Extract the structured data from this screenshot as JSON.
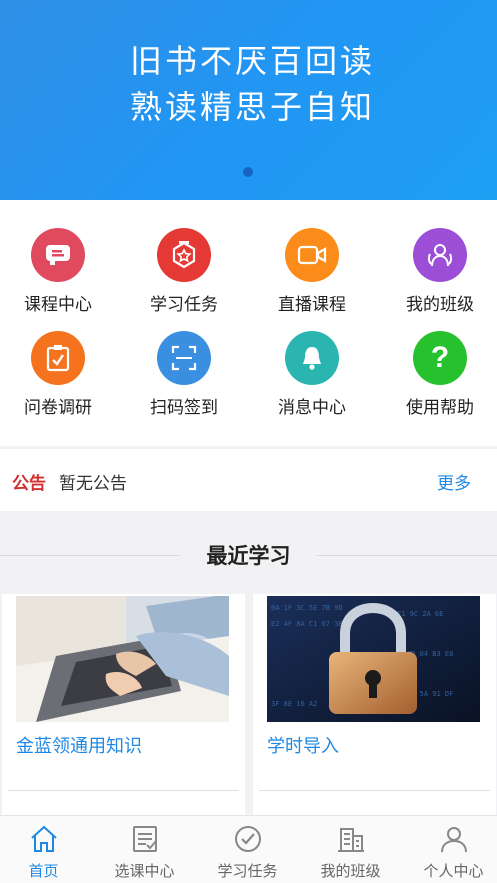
{
  "banner": {
    "line1": "旧书不厌百回读",
    "line2": "熟读精思子自知"
  },
  "menu": [
    {
      "label": "课程中心",
      "icon": "course-icon",
      "color": "#e04a5f"
    },
    {
      "label": "学习任务",
      "icon": "task-badge-icon",
      "color": "#e53935"
    },
    {
      "label": "直播课程",
      "icon": "video-camera-icon",
      "color": "#fb8c1a"
    },
    {
      "label": "我的班级",
      "icon": "class-people-icon",
      "color": "#9c4fd6"
    },
    {
      "label": "问卷调研",
      "icon": "clipboard-check-icon",
      "color": "#f5721e"
    },
    {
      "label": "扫码签到",
      "icon": "scan-qr-icon",
      "color": "#3b8fe0"
    },
    {
      "label": "消息中心",
      "icon": "bell-icon",
      "color": "#2bb5b0"
    },
    {
      "label": "使用帮助",
      "icon": "question-icon",
      "color": "#27c12d"
    }
  ],
  "notice": {
    "tag": "公告",
    "text": "暂无公告",
    "more": "更多"
  },
  "recent": {
    "title": "最近学习",
    "cards": [
      {
        "title": "金蓝领通用知识",
        "image": "laptop-typing-photo"
      },
      {
        "title": "学时导入",
        "image": "padlock-data-photo"
      }
    ]
  },
  "tabs": [
    {
      "label": "首页",
      "icon": "home-icon",
      "active": true
    },
    {
      "label": "选课中心",
      "icon": "course-list-icon",
      "active": false
    },
    {
      "label": "学习任务",
      "icon": "check-circle-icon",
      "active": false
    },
    {
      "label": "我的班级",
      "icon": "building-icon",
      "active": false
    },
    {
      "label": "个人中心",
      "icon": "user-icon",
      "active": false
    }
  ],
  "colors": {
    "accent": "#1e88e5",
    "notice_tag": "#d32f2f",
    "banner": "#2196f3"
  }
}
